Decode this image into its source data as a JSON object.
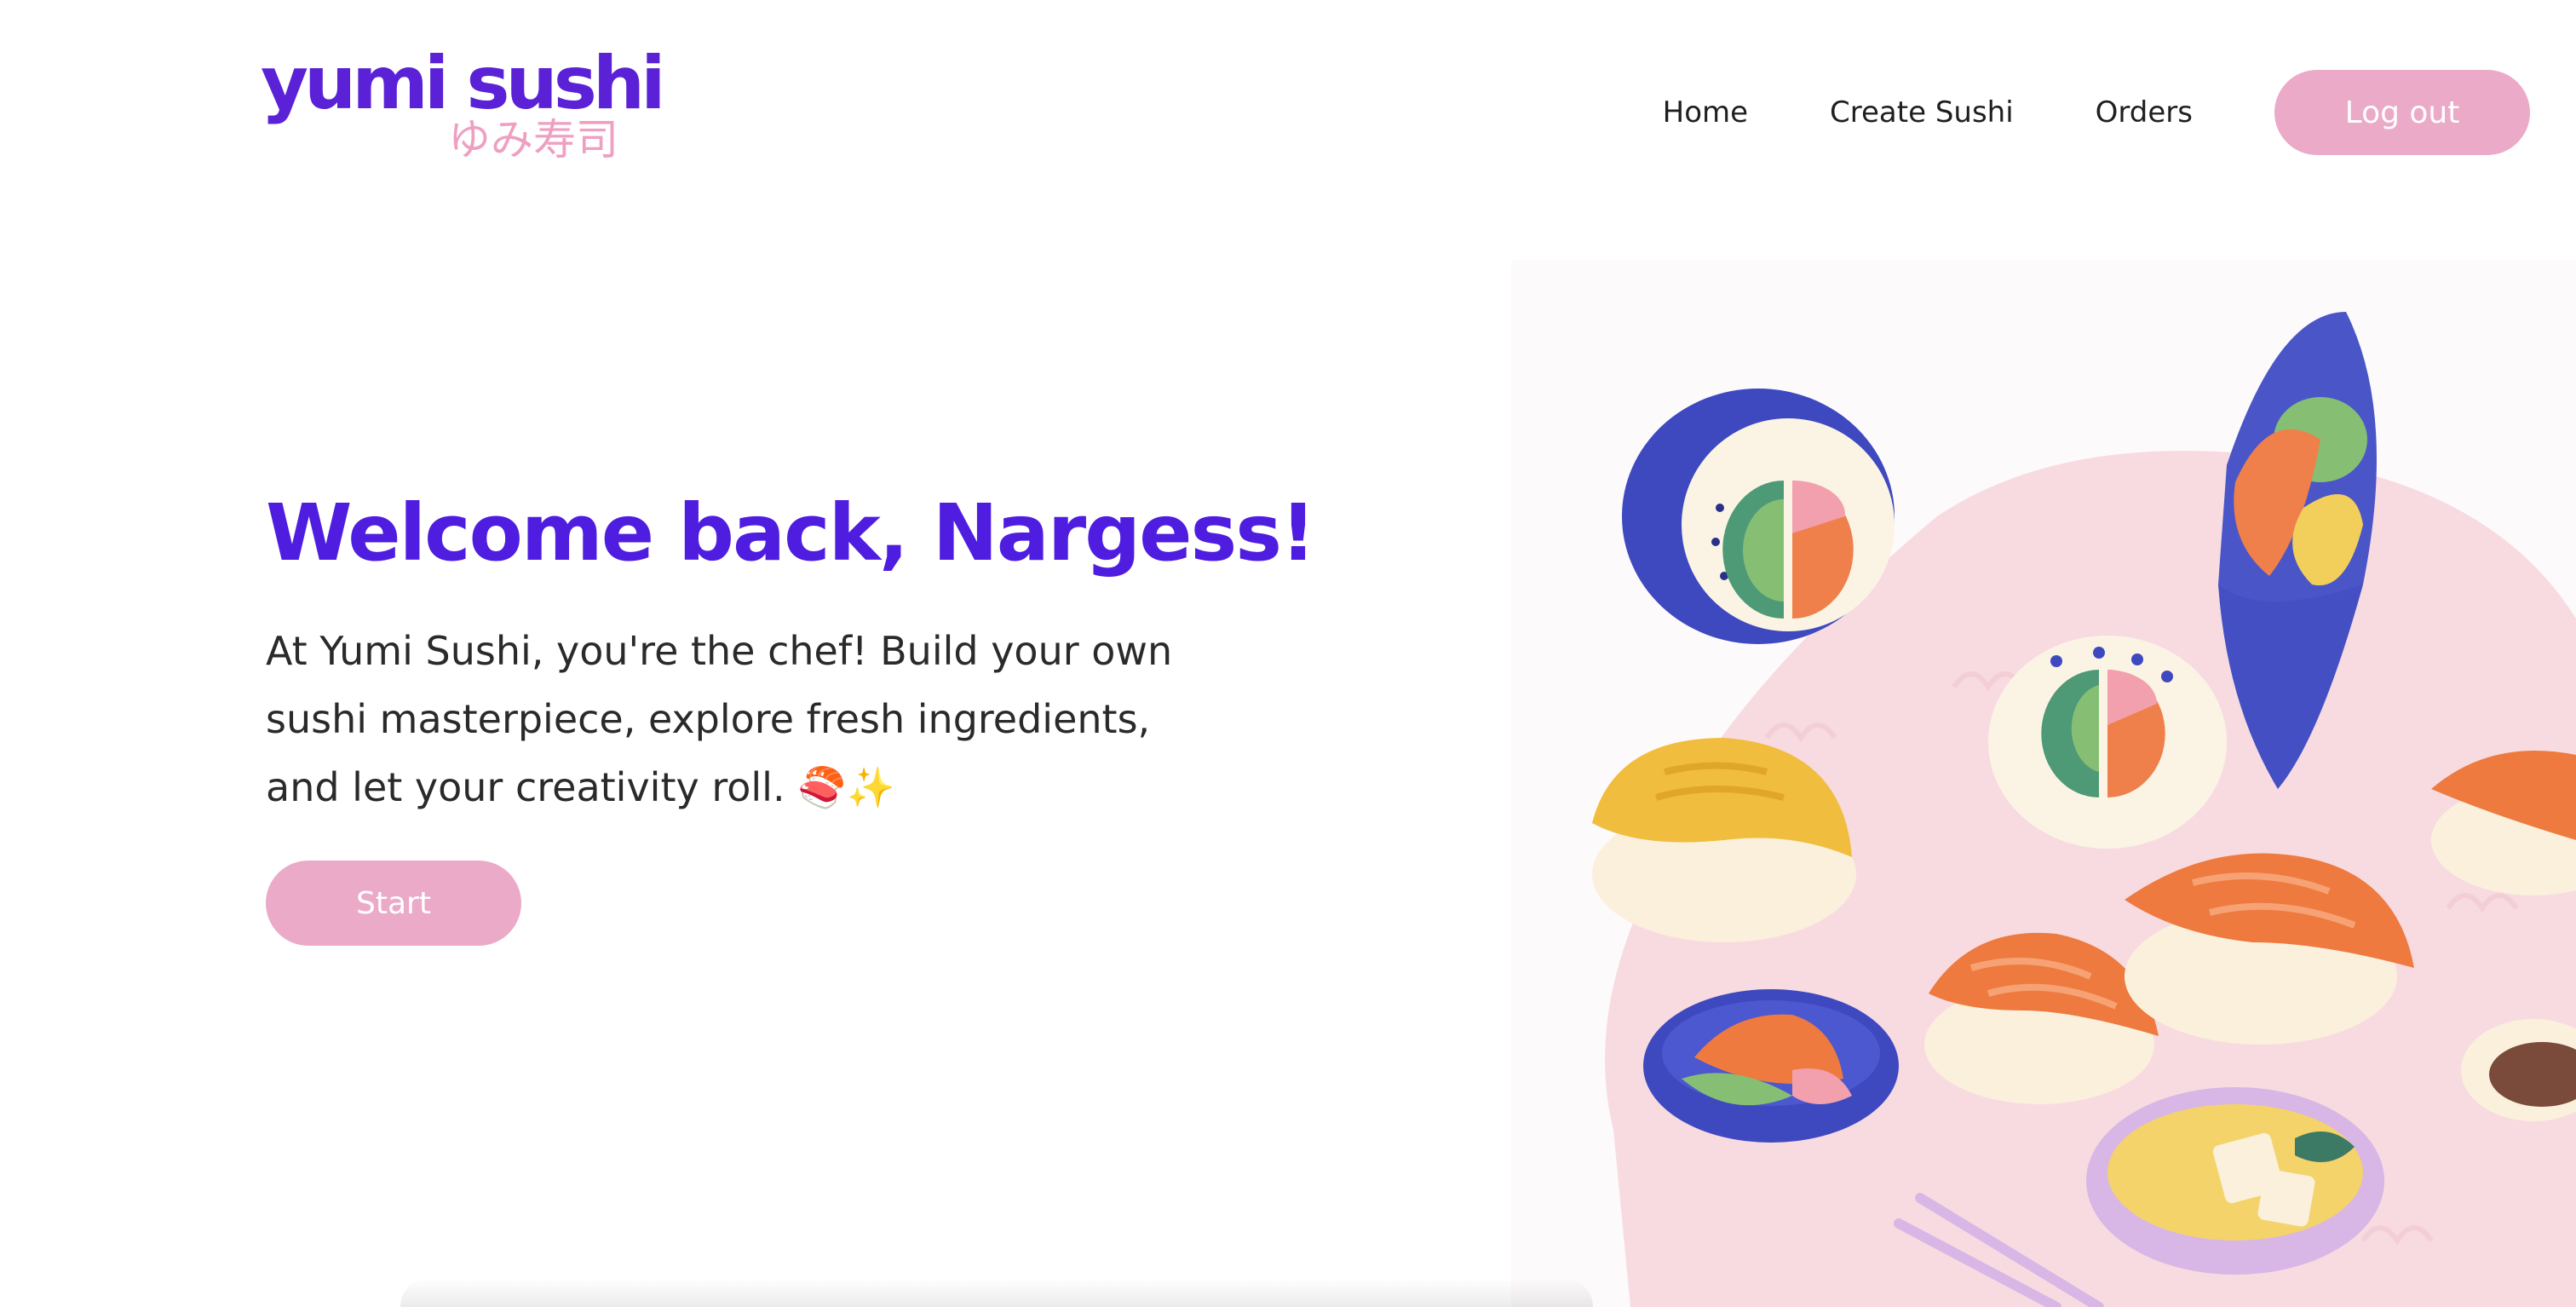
{
  "header": {
    "logo_main": "yumi sushi",
    "logo_sub": "ゆみ寿司",
    "nav": [
      {
        "label": "Home"
      },
      {
        "label": "Create Sushi"
      },
      {
        "label": "Orders"
      }
    ],
    "logout_label": "Log out"
  },
  "hero": {
    "title": "Welcome back, Nargess!",
    "description": "At Yumi Sushi, you're the chef! Build your own sushi masterpiece, explore fresh ingredients, and let your creativity roll. 🍣✨",
    "start_label": "Start"
  },
  "colors": {
    "brand_purple": "#5b21d6",
    "accent_pink": "#ebaac8",
    "logo_pink": "#ee9fc2"
  }
}
